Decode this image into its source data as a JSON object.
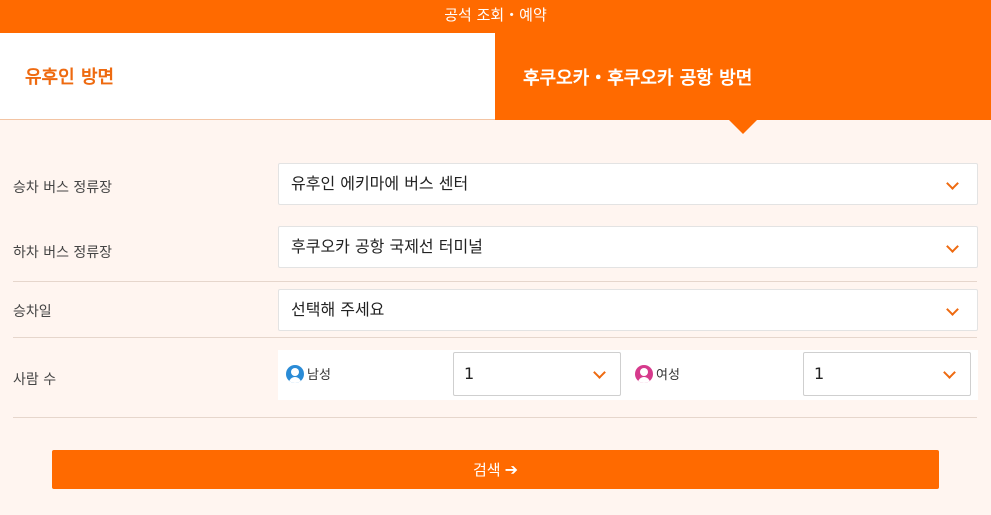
{
  "header": {
    "title": "공석 조회・예약"
  },
  "tabs": [
    {
      "label": "유후인 방면"
    },
    {
      "label": "후쿠오카・후쿠오카 공항 방면"
    }
  ],
  "form": {
    "boarding_stop": {
      "label": "승차 버스 정류장",
      "value": "유후인 에키마에 버스 센터"
    },
    "alighting_stop": {
      "label": "하차 버스 정류장",
      "value": "후쿠오카 공항 국제선 터미널"
    },
    "boarding_date": {
      "label": "승차일",
      "value": "선택해 주세요"
    },
    "passengers": {
      "label": "사람 수",
      "male": {
        "label": "남성",
        "value": "1"
      },
      "female": {
        "label": "여성",
        "value": "1"
      }
    }
  },
  "search_button": {
    "label": "검색",
    "icon": "arrow-right-icon"
  },
  "colors": {
    "accent": "#ff6a00",
    "background": "#fff5f0",
    "male_icon": "#2a8bd6",
    "female_icon": "#d63a8c"
  }
}
